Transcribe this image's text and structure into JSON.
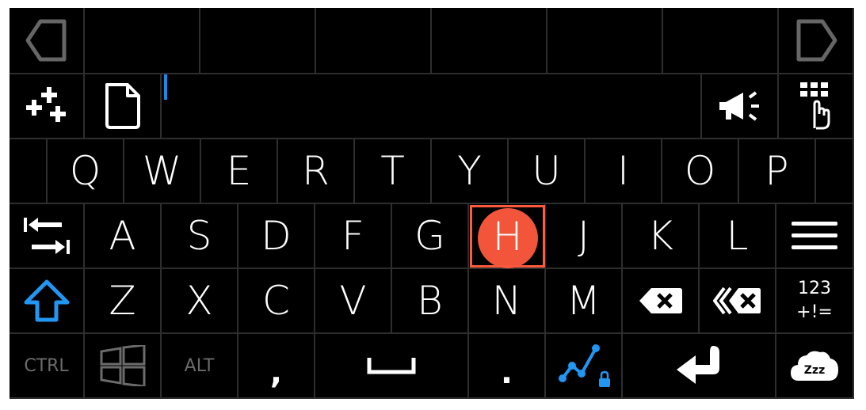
{
  "row_qwerty": [
    "Q",
    "W",
    "E",
    "R",
    "T",
    "Y",
    "U",
    "I",
    "O",
    "P"
  ],
  "row_asdf": [
    "A",
    "S",
    "D",
    "F",
    "G",
    "H",
    "J",
    "K",
    "L"
  ],
  "row_zxcv": [
    "Z",
    "X",
    "C",
    "V",
    "B",
    "N",
    "M"
  ],
  "modifiers": {
    "ctrl": "CTRL",
    "alt": "ALT"
  },
  "punct": {
    "comma": ",",
    "period": "."
  },
  "symbols_key": {
    "line1": "123",
    "line2": "+!="
  },
  "highlighted_key": "H",
  "text_input": {
    "value": ""
  },
  "colors": {
    "background": "#000000",
    "grid": "#2e2e2e",
    "accent_blue": "#2196f3",
    "highlight": "#ff5a3c",
    "dim": "#6b6b6b"
  },
  "icons": [
    "arrow-left-icon",
    "arrow-right-icon",
    "add-shortcuts-icon",
    "document-icon",
    "megaphone-icon",
    "keypad-icon",
    "switch-arrows-icon",
    "menu-icon",
    "shift-icon",
    "backspace-icon",
    "delete-word-icon",
    "windows-icon",
    "space-icon",
    "trend-chart-icon",
    "lock-icon",
    "enter-icon",
    "sleep-cloud-icon"
  ]
}
